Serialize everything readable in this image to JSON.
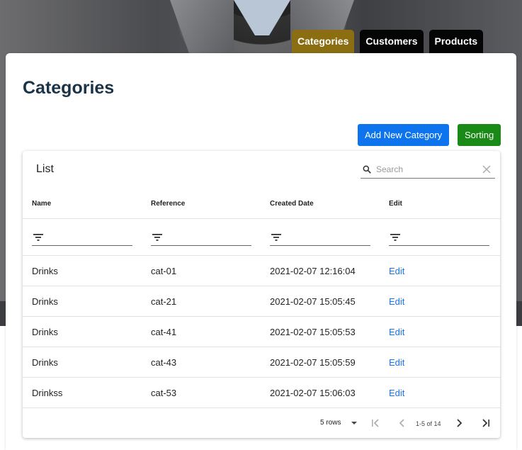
{
  "tabs": [
    {
      "label": "Categories",
      "active": true
    },
    {
      "label": "Customers",
      "active": false
    },
    {
      "label": "Products",
      "active": false
    }
  ],
  "page": {
    "title": "Categories",
    "add_button": "Add New Category",
    "sort_button": "Sorting"
  },
  "table": {
    "title": "List",
    "search_placeholder": "Search",
    "columns": [
      "Name",
      "Reference",
      "Created Date",
      "Edit"
    ],
    "rows": [
      {
        "name": "Drinks",
        "reference": "cat-01",
        "created": "2021-02-07 12:16:04",
        "edit": "Edit"
      },
      {
        "name": "Drinks",
        "reference": "cat-21",
        "created": "2021-02-07 15:05:45",
        "edit": "Edit"
      },
      {
        "name": "Drinks",
        "reference": "cat-41",
        "created": "2021-02-07 15:05:53",
        "edit": "Edit"
      },
      {
        "name": "Drinks",
        "reference": "cat-43",
        "created": "2021-02-07 15:05:59",
        "edit": "Edit"
      },
      {
        "name": "Drinkss",
        "reference": "cat-53",
        "created": "2021-02-07 15:06:03",
        "edit": "Edit"
      }
    ],
    "footer": {
      "rows_per_page": "5 rows",
      "page_info": "1-5 of 14"
    }
  },
  "icons": {
    "search": "search-icon",
    "clear": "close-icon",
    "filter": "filter-icon",
    "dropdown": "caret-down-icon",
    "first_page": "first-page-icon",
    "prev_page": "chevron-left-icon",
    "next_page": "chevron-right-icon",
    "last_page": "last-page-icon"
  },
  "colors": {
    "active_tab": "#8b6d12",
    "add_button": "#0d74ee",
    "sort_button": "#1a8a16",
    "title": "#1b3347",
    "link": "#1a73e8"
  }
}
